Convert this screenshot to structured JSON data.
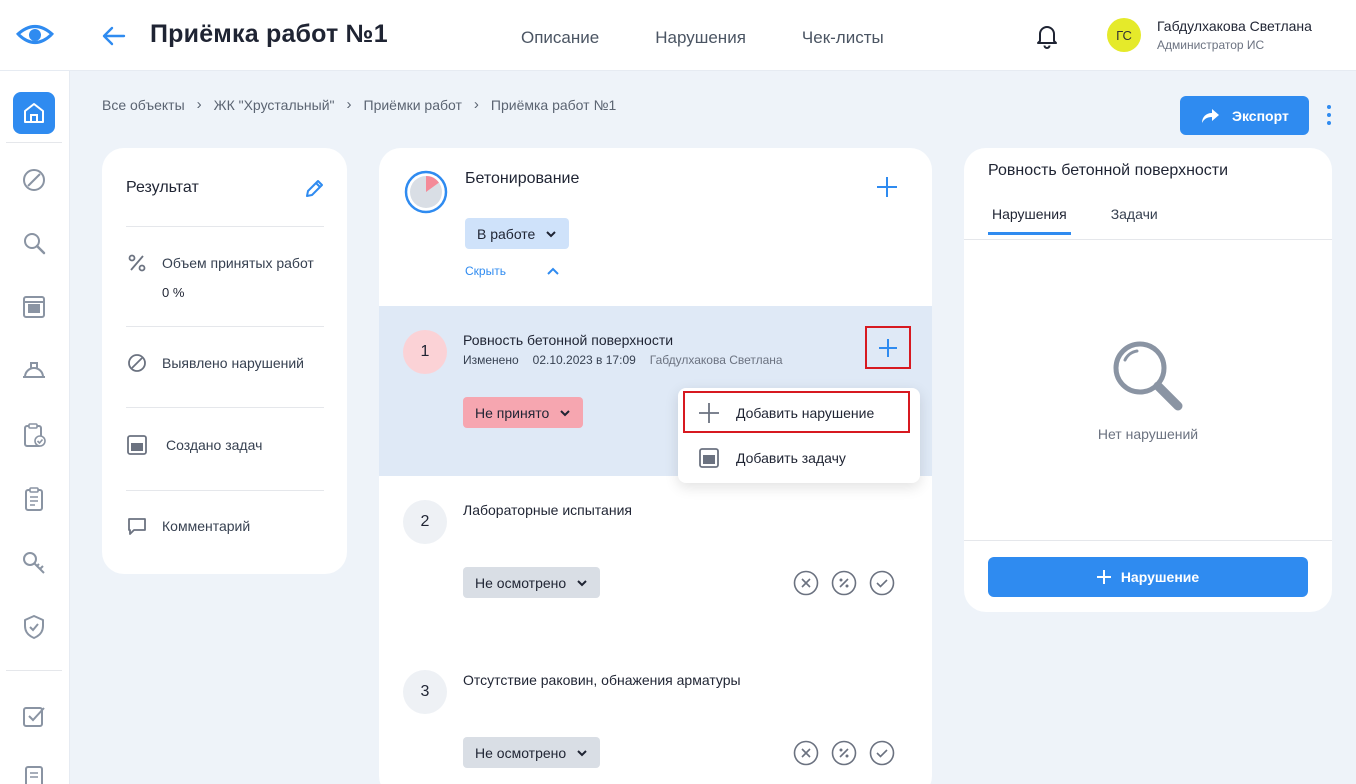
{
  "header": {
    "logo": "eye-icon",
    "title": "Приёмка работ №1",
    "tabs": [
      "Описание",
      "Нарушения",
      "Чек-листы"
    ],
    "user": {
      "initials": "ГС",
      "name": "Габдулхакова Светлана",
      "role": "Администратор ИС",
      "avatar_color": "#e5ea2a"
    }
  },
  "sidebar": {
    "icons": [
      "home-icon",
      "forbidden-icon",
      "search-icon",
      "task-icon",
      "hardhat-icon",
      "clipboard-check-icon",
      "clipboard-list-icon",
      "key-icon",
      "shield-icon",
      "checkbox-icon",
      "document-icon"
    ],
    "active_index": 0
  },
  "breadcrumb": [
    "Все объекты",
    "ЖК \"Хрустальный\"",
    "Приёмки работ",
    "Приёмка работ №1"
  ],
  "toolbar": {
    "export_label": "Экспорт"
  },
  "result": {
    "title": "Результат",
    "rows": [
      {
        "icon": "percent-icon",
        "label": "Объем принятых работ",
        "value": "0 %"
      },
      {
        "icon": "forbidden-icon",
        "label": "Выявлено нарушений"
      },
      {
        "icon": "task-icon",
        "label": "Создано задач"
      },
      {
        "icon": "comment-icon",
        "label": "Комментарий"
      }
    ]
  },
  "checklist": {
    "title": "Бетонирование",
    "progress_fraction": 0.15,
    "status": "В работе",
    "hide_label": "Скрыть",
    "items": [
      {
        "num": "1",
        "title": "Ровность бетонной поверхности",
        "changed_label": "Изменено",
        "changed_at": "02.10.2023 в 17:09",
        "author": "Габдулхакова Светлана",
        "status": "Не принято"
      },
      {
        "num": "2",
        "title": "Лабораторные испытания",
        "status": "Не осмотрено"
      },
      {
        "num": "3",
        "title": "Отсутствие раковин, обнажения арматуры",
        "status": "Не осмотрено"
      }
    ]
  },
  "dropdown": {
    "add_violation": "Добавить нарушение",
    "add_task": "Добавить задачу"
  },
  "panel": {
    "title": "Ровность бетонной поверхности",
    "tabs": [
      "Нарушения",
      "Задачи"
    ],
    "empty_text": "Нет нарушений",
    "button_label": "Нарушение"
  },
  "colors": {
    "accent": "#2f8bf0",
    "rejected": "#f6a6b0",
    "highlight_border": "#d71920"
  }
}
